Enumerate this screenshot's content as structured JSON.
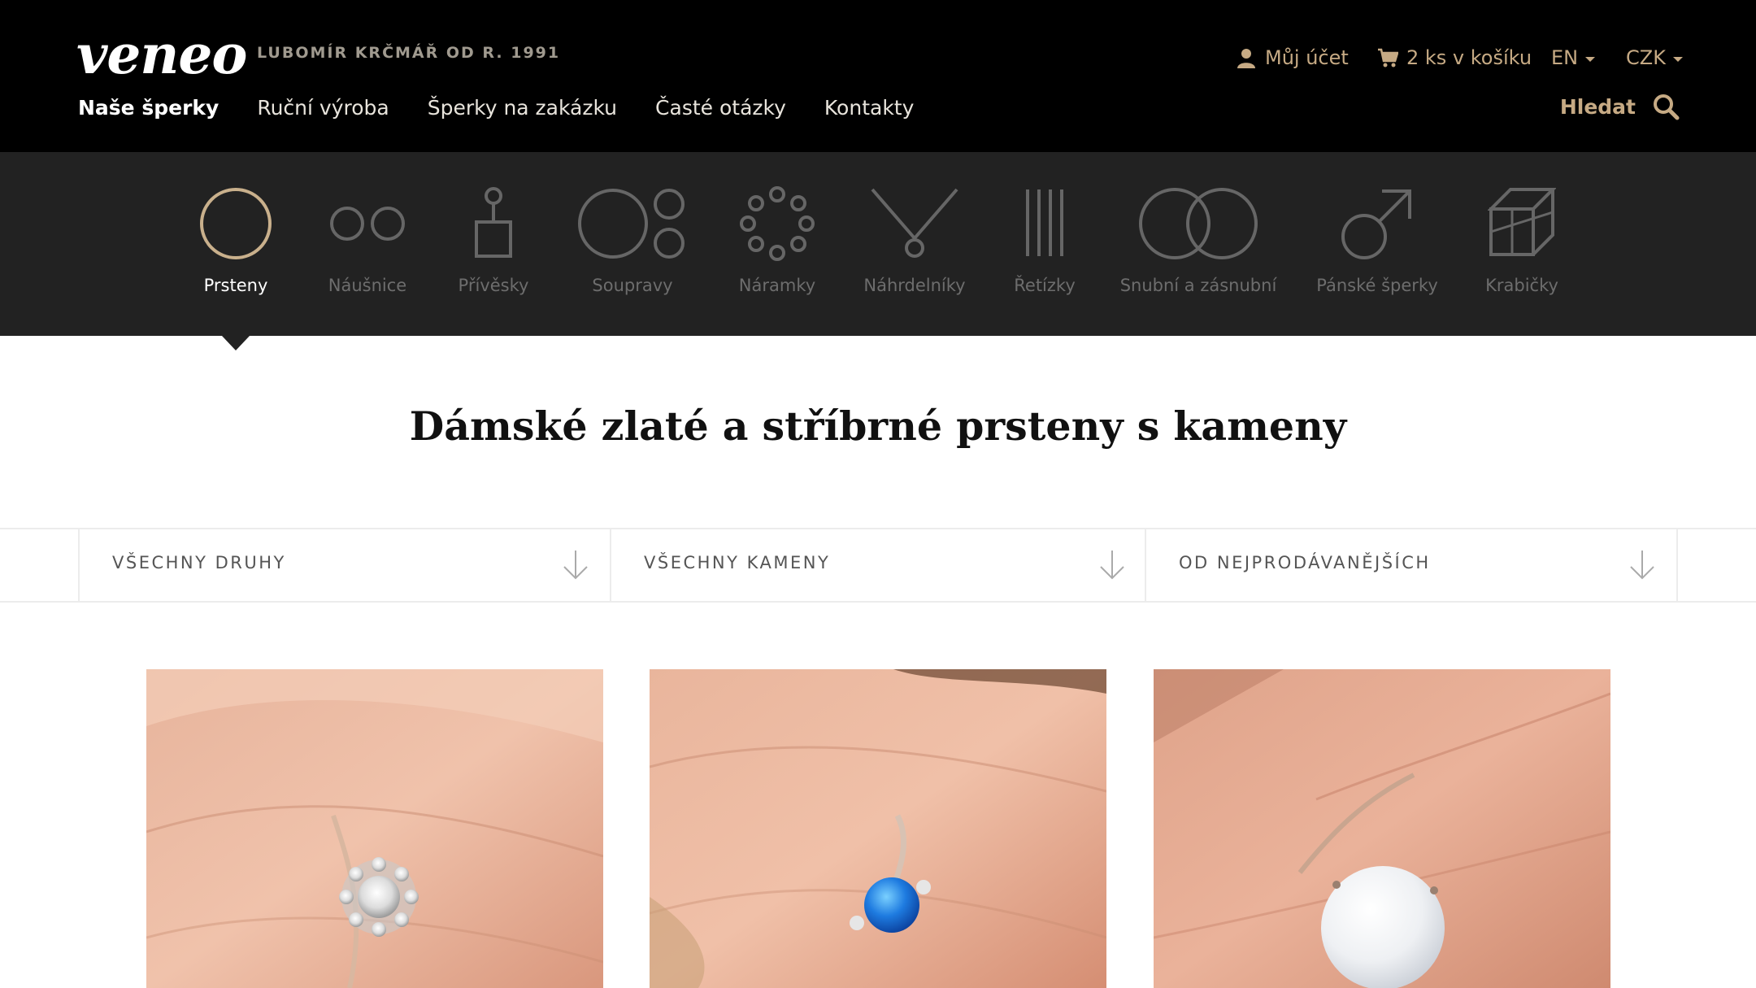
{
  "brand": {
    "logo": "veneo",
    "tagline": "LUBOMÍR KRČMÁŘ OD R. 1991"
  },
  "main_nav": [
    "Naše šperky",
    "Ruční výroba",
    "Šperky na zakázku",
    "Časté otázky",
    "Kontakty"
  ],
  "utility": {
    "account": "Můj účet",
    "cart": "2 ks v košíku",
    "language": "EN",
    "currency": "CZK",
    "search": "Hledat"
  },
  "categories": [
    "Prsteny",
    "Náušnice",
    "Přívěsky",
    "Soupravy",
    "Náramky",
    "Náhrdelníky",
    "Řetízky",
    "Snubní a zásnubní",
    "Pánské šperky",
    "Krabičky"
  ],
  "active_category": "Prsteny",
  "title": "Dámské zlaté a stříbrné prsteny s kameny",
  "filters": [
    "VŠECHNY DRUHY",
    "VŠECHNY KAMENY",
    "OD NEJPRODÁVANĚJŠÍCH"
  ],
  "products": [
    {
      "stone": "white-zircon-halo"
    },
    {
      "stone": "blue-opal"
    },
    {
      "stone": "white-opal"
    }
  ],
  "colors": {
    "header_bg": "#000000",
    "category_bg": "#222222",
    "accent_gold": "#c6aa84",
    "ring_active": "#c9b08c"
  }
}
